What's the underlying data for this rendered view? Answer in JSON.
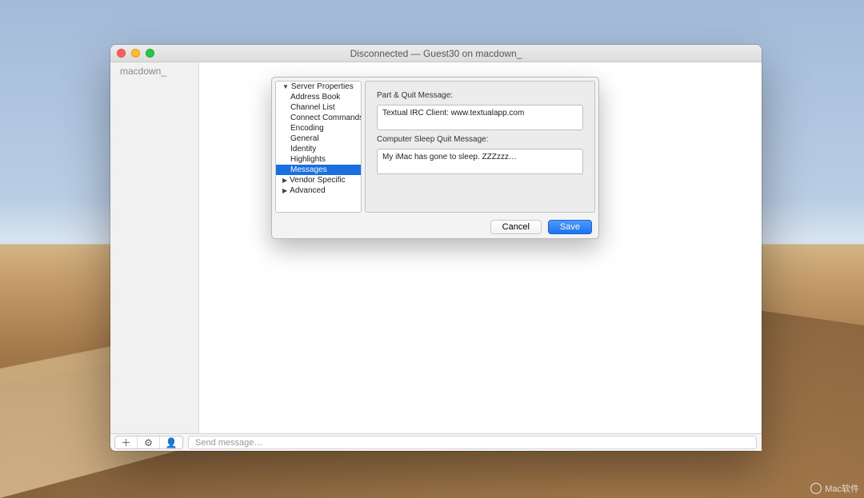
{
  "window": {
    "title": "Disconnected — Guest30 on macdown_"
  },
  "sidebar": {
    "items": [
      "macdown_"
    ]
  },
  "bottombar": {
    "add": "＋",
    "gear": "⚙",
    "user": "👤",
    "placeholder": "Send message…"
  },
  "dialog": {
    "tree": {
      "server_properties": "Server Properties",
      "items": [
        "Address Book",
        "Channel List",
        "Connect Commands",
        "Encoding",
        "General",
        "Identity",
        "Highlights",
        "Messages"
      ],
      "vendor_specific": "Vendor Specific",
      "advanced": "Advanced",
      "selected_index": 7
    },
    "panel": {
      "part_label": "Part & Quit Message:",
      "part_value": "Textual IRC Client: www.textualapp.com",
      "sleep_label": "Computer Sleep Quit Message:",
      "sleep_value": "My iMac has gone to sleep. ZZZzzz…"
    },
    "buttons": {
      "cancel": "Cancel",
      "save": "Save"
    }
  },
  "watermark": "Mac软件"
}
